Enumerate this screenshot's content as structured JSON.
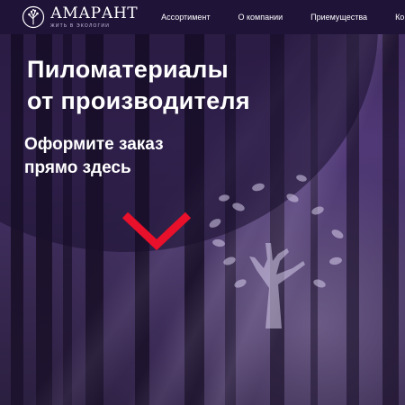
{
  "brand": {
    "name": "АМАРАНТ",
    "tagline": "ЖИТЬ В ЭКОЛОГИИ",
    "logo_icon": "tree-logo-icon"
  },
  "nav": {
    "items": [
      {
        "label": "Ассортимент"
      },
      {
        "label": "О компании"
      },
      {
        "label": "Приемущества"
      },
      {
        "label": "Ко"
      }
    ]
  },
  "hero": {
    "title_line1": "Пиломатериалы",
    "title_line2": "от производителя",
    "subtitle_line1": "Оформите заказ",
    "subtitle_line2": "прямо здесь",
    "scroll_icon": "chevron-down-icon",
    "decor_icon": "tree-emblem-icon"
  },
  "colors": {
    "navbar_bg": "#1f1338",
    "accent_red": "#e8102a",
    "text": "#ffffff"
  }
}
